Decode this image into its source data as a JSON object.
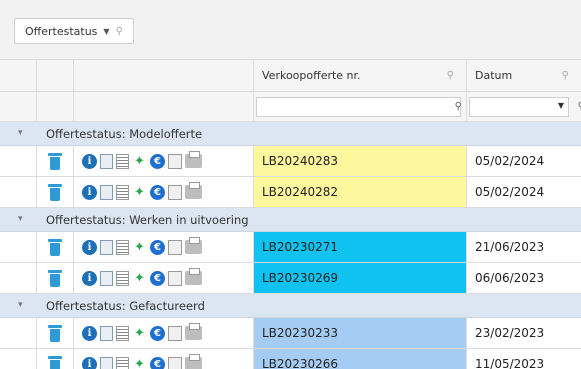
{
  "group_panel": {
    "chip_label": "Offertestatus",
    "chip_caret": "▼",
    "chip_filter": "⚲"
  },
  "columns": {
    "nr_label": "Verkoopofferte nr.",
    "date_label": "Datum",
    "filter_glyph": "⚲"
  },
  "groups": [
    {
      "label": "Offertestatus: Modelofferte",
      "rows": [
        {
          "nr": "LB20240283",
          "date": "05/02/2024",
          "color": "#fdf89d"
        },
        {
          "nr": "LB20240282",
          "date": "05/02/2024",
          "color": "#fdf89d"
        }
      ]
    },
    {
      "label": "Offertestatus: Werken in uitvoering",
      "rows": [
        {
          "nr": "LB20230271",
          "date": "21/06/2023",
          "color": "#10c2f0"
        },
        {
          "nr": "LB20230269",
          "date": "06/06/2023",
          "color": "#10c2f0"
        }
      ]
    },
    {
      "label": "Offertestatus: Gefactureerd",
      "rows": [
        {
          "nr": "LB20230233",
          "date": "23/02/2023",
          "color": "#a5cdf3"
        },
        {
          "nr": "LB20230266",
          "date": "11/05/2023",
          "color": "#a5cdf3"
        }
      ]
    }
  ],
  "row_icons": [
    "trash-icon",
    "info-icon",
    "document-icon",
    "list-icon",
    "bulb-icon",
    "euro-icon",
    "copy-icon",
    "print-icon"
  ]
}
